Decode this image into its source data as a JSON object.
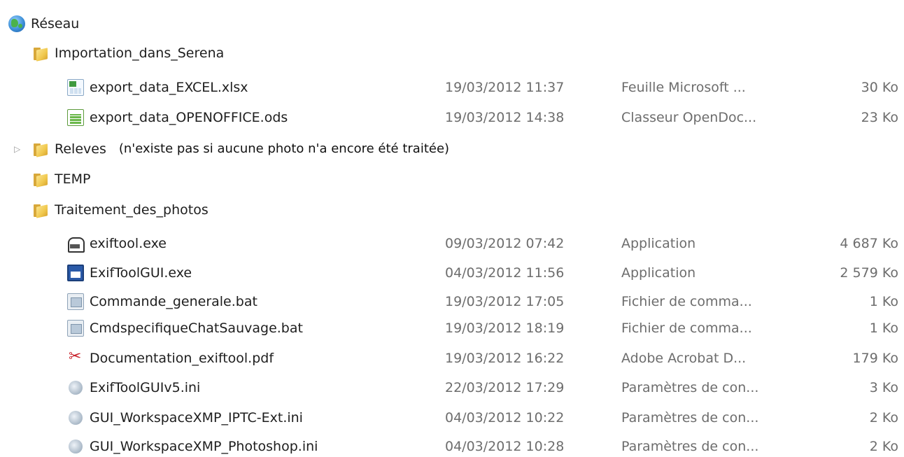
{
  "tree": {
    "root": {
      "label": "Réseau",
      "icon": "globe-icon"
    },
    "folder_import": {
      "label": "Importation_dans_Serena",
      "icon": "folder-icon"
    },
    "import_files": [
      {
        "name": "export_data_EXCEL.xlsx",
        "date": "19/03/2012 11:37",
        "type": "Feuille Microsoft ...",
        "size": "30 Ko",
        "icon": "spreadsheet-icon"
      },
      {
        "name": "export_data_OPENOFFICE.ods",
        "date": "19/03/2012 14:38",
        "type": "Classeur OpenDoc...",
        "size": "23 Ko",
        "icon": "spreadsheet-icon"
      }
    ],
    "folder_releves": {
      "label": "Releves",
      "icon": "folder-icon",
      "note": "(n'existe pas si aucune photo n'a encore été traitée)"
    },
    "folder_temp": {
      "label": "TEMP",
      "icon": "folder-icon"
    },
    "folder_traitement": {
      "label": "Traitement_des_photos",
      "icon": "folder-icon"
    },
    "traitement_files": [
      {
        "name": "exiftool.exe",
        "date": "09/03/2012 07:42",
        "type": "Application",
        "size": "4 687 Ko",
        "icon": "exe-icon"
      },
      {
        "name": "ExifToolGUI.exe",
        "date": "04/03/2012 11:56",
        "type": "Application",
        "size": "2 579 Ko",
        "icon": "app-icon"
      },
      {
        "name": "Commande_generale.bat",
        "date": "19/03/2012 17:05",
        "type": "Fichier de comma...",
        "size": "1 Ko",
        "icon": "batch-file-icon"
      },
      {
        "name": "CmdspecifiqueChatSauvage.bat",
        "date": "19/03/2012 18:19",
        "type": "Fichier de comma...",
        "size": "1 Ko",
        "icon": "batch-file-icon"
      },
      {
        "name": "Documentation_exiftool.pdf",
        "date": "19/03/2012 16:22",
        "type": "Adobe Acrobat D...",
        "size": "179 Ko",
        "icon": "pdf-icon"
      },
      {
        "name": "ExifToolGUIv5.ini",
        "date": "22/03/2012 17:29",
        "type": "Paramètres de con...",
        "size": "3 Ko",
        "icon": "ini-icon"
      },
      {
        "name": "GUI_WorkspaceXMP_IPTC-Ext.ini",
        "date": "04/03/2012 10:22",
        "type": "Paramètres de con...",
        "size": "2 Ko",
        "icon": "ini-icon"
      },
      {
        "name": "GUI_WorkspaceXMP_Photoshop.ini",
        "date": "04/03/2012 10:28",
        "type": "Paramètres de con...",
        "size": "2 Ko",
        "icon": "ini-icon"
      }
    ]
  }
}
